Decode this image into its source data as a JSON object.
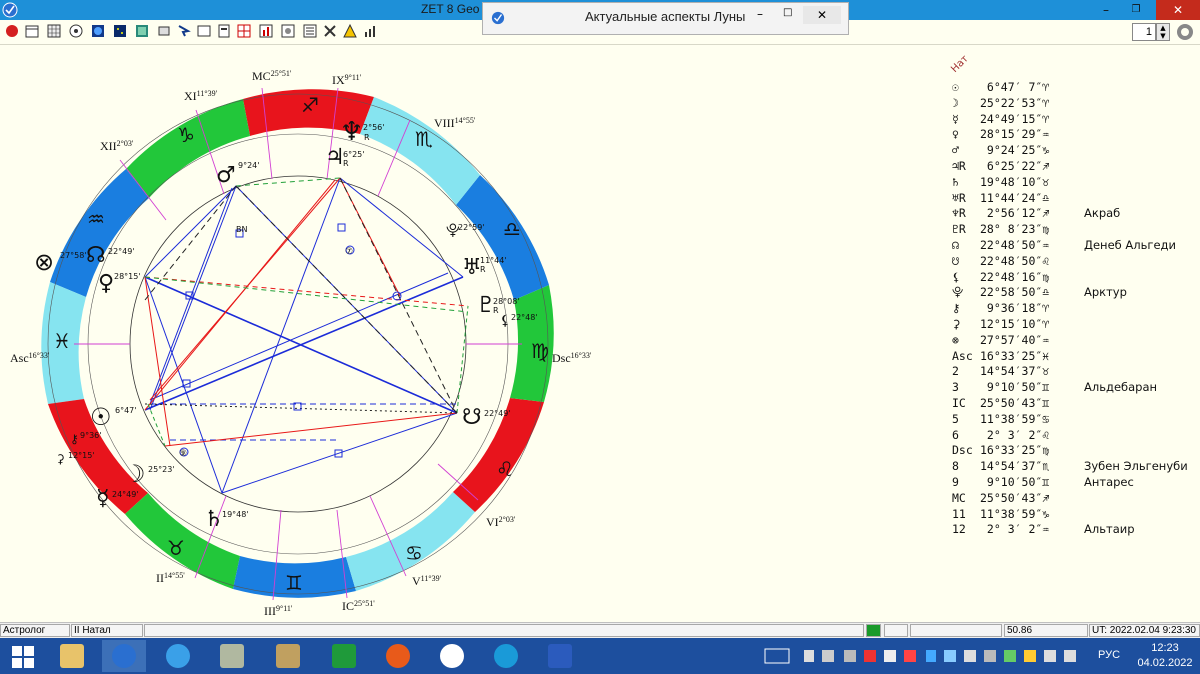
{
  "window": {
    "title": "ZET 8 Geo",
    "page_number": "1"
  },
  "popup": {
    "title": "Актуальные аспекты Луны"
  },
  "natal_label": "Нат",
  "wheel": {
    "houses": [
      {
        "label": "MC",
        "deg": "25°51'"
      },
      {
        "label": "IX",
        "deg": "9°11'"
      },
      {
        "label": "XI",
        "deg": "11°39'"
      },
      {
        "label": "VIII",
        "deg": "14°55'"
      },
      {
        "label": "XII",
        "deg": "2°03'"
      },
      {
        "label": "Asc",
        "deg": "16°33'"
      },
      {
        "label": "Dsc",
        "deg": "16°33'"
      },
      {
        "label": "VI",
        "deg": "2°03'"
      },
      {
        "label": "II",
        "deg": "14°55'"
      },
      {
        "label": "V",
        "deg": "11°39'"
      },
      {
        "label": "III",
        "deg": "9°11'"
      },
      {
        "label": "IC",
        "deg": "25°51'"
      }
    ],
    "planets": [
      {
        "glyph": "♆",
        "deg": "2°56'",
        "r": "R"
      },
      {
        "glyph": "♃",
        "deg": "6°25'",
        "r": "R"
      },
      {
        "glyph": "♂",
        "deg": "9°24'",
        "r": ""
      },
      {
        "glyph": "⊗",
        "deg": "27°58'",
        "r": ""
      },
      {
        "glyph": "☊",
        "deg": "22°49'",
        "r": ""
      },
      {
        "glyph": "♀",
        "deg": "28°15'",
        "r": ""
      },
      {
        "glyph": "⯓",
        "deg": "22°59'",
        "r": ""
      },
      {
        "glyph": "♅",
        "deg": "11°44'",
        "r": "R"
      },
      {
        "glyph": "♇",
        "deg": "28°08'",
        "r": "R"
      },
      {
        "glyph": "⚸",
        "deg": "22°48'",
        "r": ""
      },
      {
        "glyph": "☋",
        "deg": "22°49'",
        "r": ""
      },
      {
        "glyph": "☉",
        "deg": "6°47'",
        "r": ""
      },
      {
        "glyph": "⚷",
        "deg": "9°36'",
        "r": ""
      },
      {
        "glyph": "⚳",
        "deg": "12°15'",
        "r": ""
      },
      {
        "glyph": "☽",
        "deg": "25°23'",
        "r": ""
      },
      {
        "glyph": "☿",
        "deg": "24°49'",
        "r": ""
      },
      {
        "glyph": "♄",
        "deg": "19°48'",
        "r": ""
      }
    ],
    "markers": [
      "BN",
      "⑦",
      "⑨"
    ]
  },
  "positions": [
    {
      "sym": "☉",
      "deg": " 6°47′ 7″♈",
      "star": ""
    },
    {
      "sym": "☽",
      "deg": "25°22′53″♈",
      "star": ""
    },
    {
      "sym": "☿",
      "deg": "24°49′15″♈",
      "star": ""
    },
    {
      "sym": "♀",
      "deg": "28°15′29″♒",
      "star": ""
    },
    {
      "sym": "♂",
      "deg": " 9°24′25″♑",
      "star": ""
    },
    {
      "sym": "♃R",
      "deg": " 6°25′22″♐",
      "star": ""
    },
    {
      "sym": "♄",
      "deg": "19°48′10″♉",
      "star": ""
    },
    {
      "sym": "♅R",
      "deg": "11°44′24″♎",
      "star": ""
    },
    {
      "sym": "♆R",
      "deg": " 2°56′12″♐",
      "star": "Акраб"
    },
    {
      "sym": "♇R",
      "deg": "28° 8′23″♍",
      "star": ""
    },
    {
      "sym": "☊",
      "deg": "22°48′50″♒",
      "star": "Денеб Альгеди"
    },
    {
      "sym": "☋",
      "deg": "22°48′50″♌",
      "star": ""
    },
    {
      "sym": "⚸",
      "deg": "22°48′16″♍",
      "star": ""
    },
    {
      "sym": "⯓",
      "deg": "22°58′50″♎",
      "star": "Арктур"
    },
    {
      "sym": "⚷",
      "deg": " 9°36′18″♈",
      "star": ""
    },
    {
      "sym": "⚳",
      "deg": "12°15′10″♈",
      "star": ""
    },
    {
      "sym": "⊗",
      "deg": "27°57′40″♒",
      "star": ""
    },
    {
      "sym": "Asc",
      "deg": "16°33′25″♓",
      "star": ""
    },
    {
      "sym": "2",
      "deg": "14°54′37″♉",
      "star": ""
    },
    {
      "sym": "3",
      "deg": " 9°10′50″♊",
      "star": "Альдебаран"
    },
    {
      "sym": "IC",
      "deg": "25°50′43″♊",
      "star": ""
    },
    {
      "sym": "5",
      "deg": "11°38′59″♋",
      "star": ""
    },
    {
      "sym": "6",
      "deg": " 2° 3′ 2″♌",
      "star": ""
    },
    {
      "sym": "Dsc",
      "deg": "16°33′25″♍",
      "star": ""
    },
    {
      "sym": "8",
      "deg": "14°54′37″♏",
      "star": "Зубен Эльгенуби"
    },
    {
      "sym": "9",
      "deg": " 9°10′50″♊",
      "star": "Антарес"
    },
    {
      "sym": "MC",
      "deg": "25°50′43″♐",
      "star": ""
    },
    {
      "sym": "11",
      "deg": "11°38′59″♑",
      "star": ""
    },
    {
      "sym": "12",
      "deg": " 2° 3′ 2″♒",
      "star": "Альтаир"
    }
  ],
  "status": {
    "user": "Астролог",
    "chart": "II Натал",
    "value": "50.86",
    "ut": "UT: 2022.02.04  9:23:30"
  },
  "taskbar": {
    "lang": "РУС",
    "time": "12:23",
    "date": "04.02.2022"
  },
  "colors": {
    "red": "#e8141c",
    "green": "#22c73a",
    "blue": "#1a7ee0",
    "cyan": "#86e4f0",
    "title_bg": "#1e90d8",
    "taskbar": "#1d4f9e"
  }
}
